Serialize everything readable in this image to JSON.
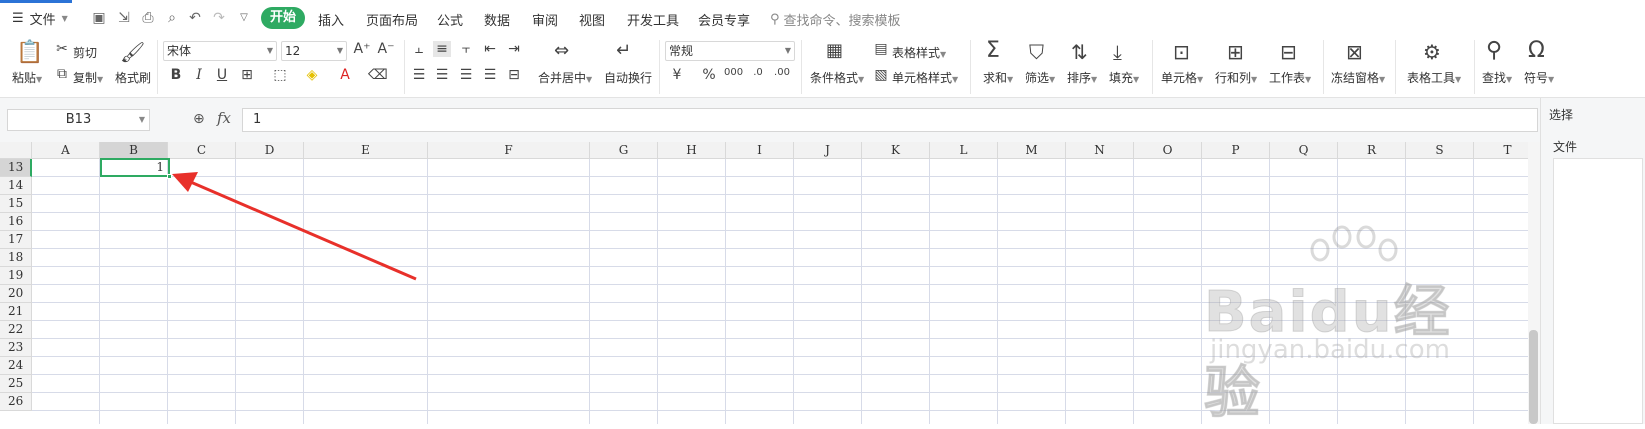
{
  "menubar": {
    "file_label": "文件",
    "tabs": [
      "插入",
      "页面布局",
      "公式",
      "数据",
      "审阅",
      "视图",
      "开发工具",
      "会员专享"
    ],
    "active_tab": "开始",
    "search_placeholder": "查找命令、搜索模板"
  },
  "ribbon": {
    "paste": "粘贴",
    "cut": "剪切",
    "copy": "复制",
    "format_painter": "格式刷",
    "font_name": "宋体",
    "font_size": "12",
    "merge_center": "合并居中",
    "wrap_text": "自动换行",
    "number_format": "常规",
    "conditional_format": "条件格式",
    "table_style": "表格样式",
    "cell_style": "单元格样式",
    "sum": "求和",
    "filter": "筛选",
    "sort": "排序",
    "fill": "填充",
    "cell": "单元格",
    "row_col": "行和列",
    "worksheet": "工作表",
    "freeze": "冻结窗格",
    "table_tools": "表格工具",
    "find": "查找",
    "symbol": "符号"
  },
  "formula_bar": {
    "name_box": "B13",
    "fx_label": "fx",
    "value": "1"
  },
  "sheet": {
    "columns": [
      "A",
      "B",
      "C",
      "D",
      "E",
      "F",
      "G",
      "H",
      "I",
      "J",
      "K",
      "L",
      "M",
      "N",
      "O",
      "P",
      "Q",
      "R",
      "S",
      "T"
    ],
    "rows": [
      "13",
      "14",
      "15",
      "16",
      "17",
      "18",
      "19",
      "20",
      "21",
      "22",
      "23",
      "24",
      "25",
      "26"
    ],
    "selected_cell": "B13",
    "selected_value": "1"
  },
  "right_pane": {
    "label_top": "选择",
    "label_section": "文件"
  },
  "watermark": {
    "main": "Baidu经验",
    "sub": "jingyan.baidu.com"
  },
  "colors": {
    "accent_green": "#2eaa62",
    "annotation_red": "#e8302a"
  }
}
